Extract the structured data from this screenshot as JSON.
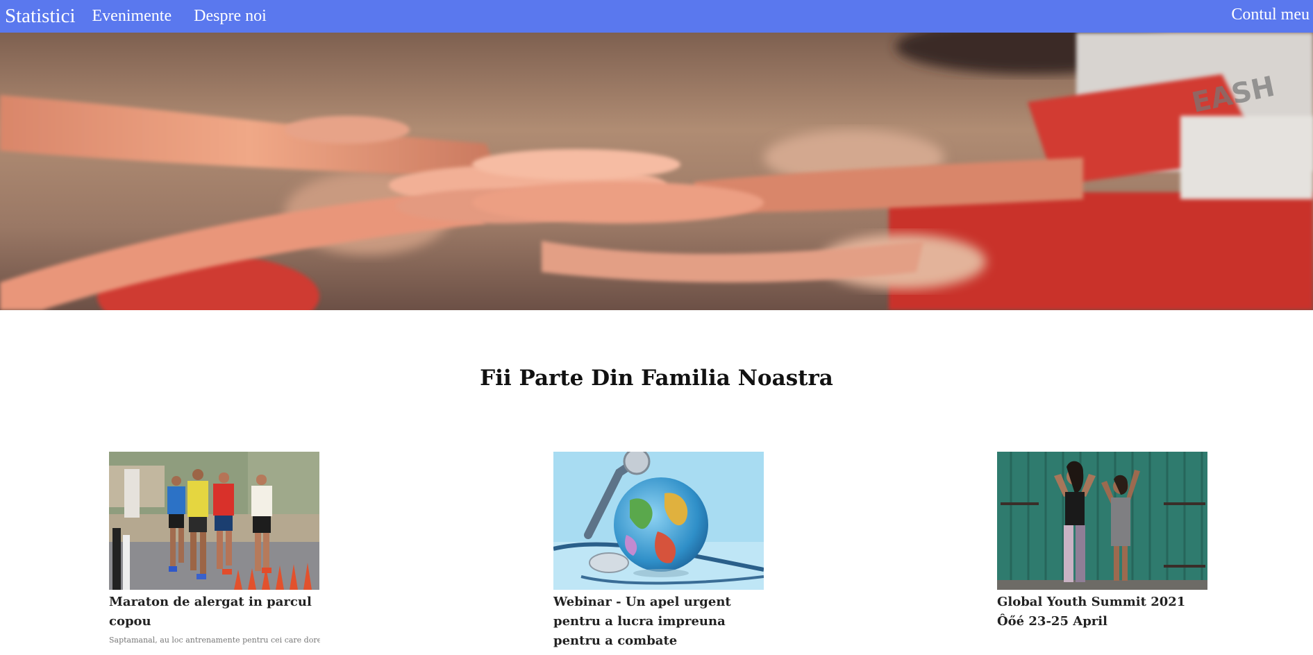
{
  "navbar": {
    "brand": "Statistici",
    "links": [
      "Evenimente",
      "Despre noi"
    ],
    "account": "Contul meu",
    "color": "#5a78ee"
  },
  "hero": {
    "image": "stacked-hands-teamwork-photo"
  },
  "section": {
    "title": "Fii Parte Din Familia Noastra"
  },
  "cards": [
    {
      "image": "marathon-runners-photo",
      "title": "Maraton de alergat in parcul copou",
      "description": "Saptamanal, au loc antrenamente pentru cei care doresc sa se"
    },
    {
      "image": "globe-with-stethoscope-photo",
      "title": "Webinar - Un apel urgent pentru a lucra impreuna pentru a combate",
      "description": ""
    },
    {
      "image": "two-women-flexing-photo",
      "title": "Global Youth Summit 2021 Ôőé 23-25 April",
      "description": ""
    }
  ]
}
